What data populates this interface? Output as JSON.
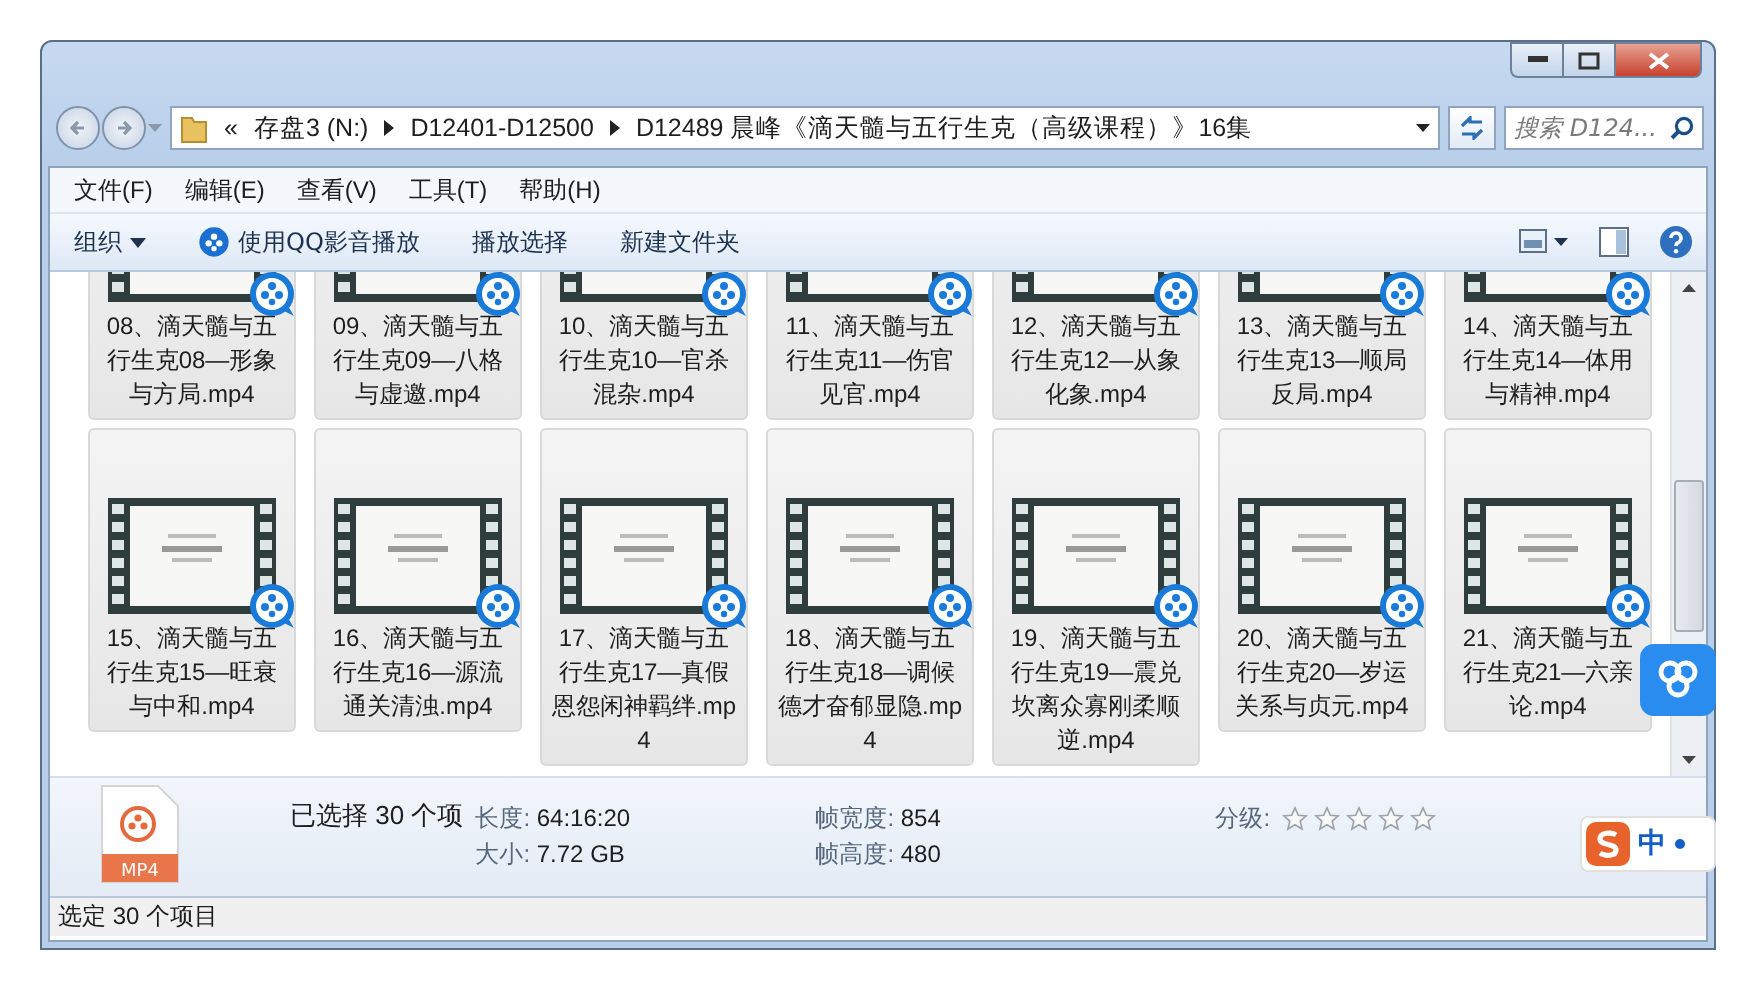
{
  "address": {
    "overflow": "«",
    "segments": [
      "存盘3 (N:)",
      "D12401-D12500",
      "D12489 晨峰《滴天髓与五行生克（高级课程）》16集"
    ]
  },
  "search": {
    "placeholder": "搜索 D124..."
  },
  "menu": [
    "文件(F)",
    "编辑(E)",
    "查看(V)",
    "工具(T)",
    "帮助(H)"
  ],
  "toolbar": [
    {
      "label": "组织",
      "kind": "dropdown"
    },
    {
      "label": "使用QQ影音播放",
      "kind": "player"
    },
    {
      "label": "播放选择",
      "kind": "plain"
    },
    {
      "label": "新建文件夹",
      "kind": "plain"
    }
  ],
  "files": [
    {
      "name": "08、滴天髓与五行生克08—形象与方局.mp4",
      "selected": true
    },
    {
      "name": "09、滴天髓与五行生克09—八格与虚邀.mp4",
      "selected": true
    },
    {
      "name": "10、滴天髓与五行生克10—官杀混杂.mp4",
      "selected": true
    },
    {
      "name": "11、滴天髓与五行生克11—伤官见官.mp4",
      "selected": true
    },
    {
      "name": "12、滴天髓与五行生克12—从象化象.mp4",
      "selected": true
    },
    {
      "name": "13、滴天髓与五行生克13—顺局反局.mp4",
      "selected": true
    },
    {
      "name": "14、滴天髓与五行生克14—体用与精神.mp4",
      "selected": true
    },
    {
      "name": "15、滴天髓与五行生克15—旺衰与中和.mp4",
      "selected": true
    },
    {
      "name": "16、滴天髓与五行生克16—源流通关清浊.mp4",
      "selected": true
    },
    {
      "name": "17、滴天髓与五行生克17—真假恩怨闲神羁绊.mp4",
      "selected": true
    },
    {
      "name": "18、滴天髓与五行生克18—调候德才奋郁显隐.mp4",
      "selected": true
    },
    {
      "name": "19、滴天髓与五行生克19—震兑坎离众寡刚柔顺逆.mp4",
      "selected": true
    },
    {
      "name": "20、滴天髓与五行生克20—岁运关系与贞元.mp4",
      "selected": true
    },
    {
      "name": "21、滴天髓与五行生克21—六亲论.mp4",
      "selected": true
    }
  ],
  "details": {
    "file_type": "MP4",
    "selection": "已选择 30 个项",
    "properties": [
      {
        "label": "长度:",
        "value": "64:16:20"
      },
      {
        "label": "大小:",
        "value": "7.72 GB"
      },
      {
        "label": "帧宽度:",
        "value": "854"
      },
      {
        "label": "帧高度:",
        "value": "480"
      }
    ],
    "rating": {
      "label": "分级:",
      "stars": 0
    }
  },
  "status_bar": "选定 30 个项目",
  "ime": {
    "label": "中"
  }
}
